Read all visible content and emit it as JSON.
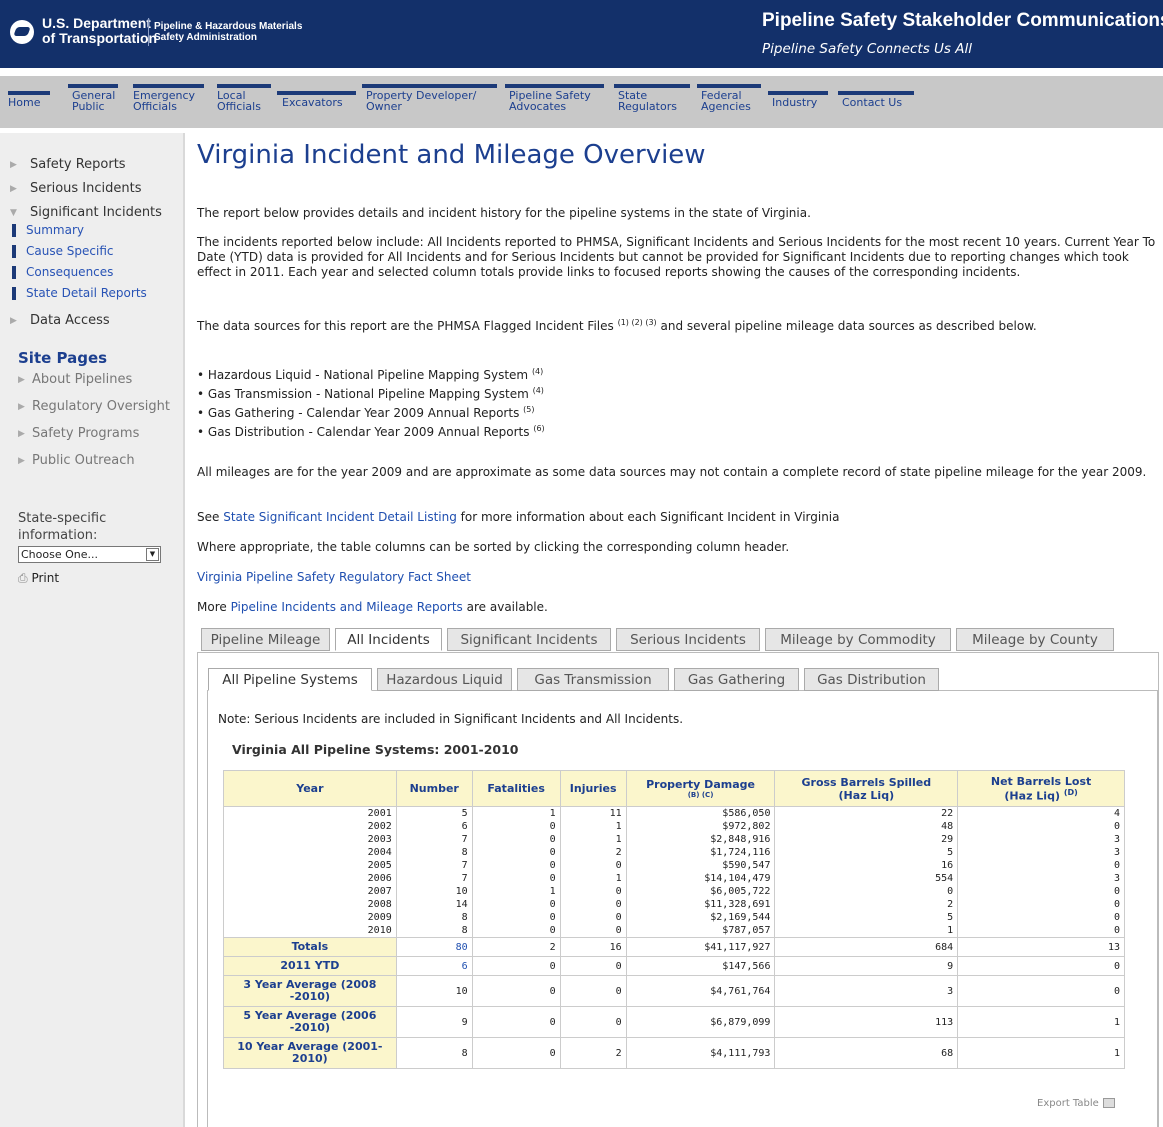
{
  "header": {
    "dept_line1": "U.S. Department",
    "dept_line2": "of Transportation",
    "phmsa_line1": "Pipeline & Hazardous Materials",
    "phmsa_line2": "Safety Administration",
    "title": "Pipeline Safety Stakeholder Communications",
    "subtitle": "Pipeline Safety Connects Us All"
  },
  "nav": {
    "home": "Home",
    "general_public_1": "General",
    "general_public_2": "Public",
    "emergency_1": "Emergency",
    "emergency_2": "Officials",
    "local_1": "Local",
    "local_2": "Officials",
    "excavators": "Excavators",
    "property_1": "Property Developer/",
    "property_2": "Owner",
    "advocates_1": "Pipeline Safety",
    "advocates_2": "Advocates",
    "state_1": "State",
    "state_2": "Regulators",
    "federal_1": "Federal",
    "federal_2": "Agencies",
    "industry": "Industry",
    "contact": "Contact Us"
  },
  "sidebar": {
    "safety_reports": "Safety Reports",
    "serious_incidents": "Serious Incidents",
    "significant_incidents": "Significant Incidents",
    "summary": "Summary",
    "cause_specific": "Cause Specific",
    "consequences": "Consequences",
    "state_detail": "State Detail Reports",
    "data_access": "Data Access",
    "site_pages": "Site Pages",
    "about": "About Pipelines",
    "regulatory": "Regulatory Oversight",
    "safety_programs": "Safety Programs",
    "public_outreach": "Public Outreach",
    "state_label_1": "State-specific",
    "state_label_2": "information:",
    "select_value": "Choose One...",
    "print": "Print"
  },
  "main": {
    "title": "Virginia Incident and Mileage Overview",
    "p1": "The report below provides details and incident history for the pipeline systems in the state of Virginia.",
    "p2": "The incidents reported below include: All Incidents reported to PHMSA, Significant Incidents and Serious Incidents for the most recent 10 years. Current Year To Date (YTD) data is provided for All Incidents and for Serious Incidents but cannot be provided for Significant Incidents due to reporting changes which took effect in 2011. Each year and selected column totals provide links to focused reports showing the causes of the corresponding incidents.",
    "p3": "The data sources for this report are the PHMSA Flagged Incident Files",
    "p3_refs": "(1) (2) (3)",
    "p3_tail": "and several pipeline mileage data sources as described below.",
    "bullets": [
      {
        "text": "Hazardous Liquid - National Pipeline Mapping System",
        "ref": "(4)"
      },
      {
        "text": "Gas Transmission - National Pipeline Mapping System",
        "ref": "(4)"
      },
      {
        "text": "Gas Gathering - Calendar Year 2009 Annual Reports",
        "ref": "(5)"
      },
      {
        "text": "Gas Distribution - Calendar Year 2009 Annual Reports",
        "ref": "(6)"
      }
    ],
    "p4": "All mileages are for the year 2009 and are approximate as some data sources may not contain a complete record of state pipeline mileage for the year 2009.",
    "p5_pre": "See",
    "p5_link": "State Significant Incident Detail Listing",
    "p5_post": "for more information about each Significant Incident in Virginia",
    "p6": "Where appropriate, the table columns can be sorted by clicking the corresponding column header.",
    "fact_sheet": "Virginia Pipeline Safety Regulatory Fact Sheet",
    "p7_pre": "More",
    "p7_link": "Pipeline Incidents and Mileage Reports",
    "p7_post": "are available."
  },
  "tabs1": [
    "Pipeline Mileage",
    "All Incidents",
    "Significant Incidents",
    "Serious Incidents",
    "Mileage by Commodity",
    "Mileage by County"
  ],
  "tabs2": [
    "All Pipeline Systems",
    "Hazardous Liquid",
    "Gas Transmission",
    "Gas Gathering",
    "Gas Distribution"
  ],
  "note": "Note: Serious Incidents are included in Significant Incidents and All Incidents.",
  "table_title": "Virginia All Pipeline Systems: 2001-2010",
  "table": {
    "headers": {
      "year": "Year",
      "number": "Number",
      "fatalities": "Fatalities",
      "injuries": "Injuries",
      "property": "Property Damage",
      "property_refs": "(B) (C)",
      "gross_1": "Gross Barrels Spilled",
      "gross_2": "(Haz Liq)",
      "net_1": "Net Barrels Lost",
      "net_2": "(Haz Liq)",
      "net_ref": "(D)"
    },
    "rows": [
      [
        "2001",
        "5",
        "1",
        "11",
        "$586,050",
        "22",
        "4"
      ],
      [
        "2002",
        "6",
        "0",
        "1",
        "$972,802",
        "48",
        "0"
      ],
      [
        "2003",
        "7",
        "0",
        "1",
        "$2,848,916",
        "29",
        "3"
      ],
      [
        "2004",
        "8",
        "0",
        "2",
        "$1,724,116",
        "5",
        "3"
      ],
      [
        "2005",
        "7",
        "0",
        "0",
        "$590,547",
        "16",
        "0"
      ],
      [
        "2006",
        "7",
        "0",
        "1",
        "$14,104,479",
        "554",
        "3"
      ],
      [
        "2007",
        "10",
        "1",
        "0",
        "$6,005,722",
        "0",
        "0"
      ],
      [
        "2008",
        "14",
        "0",
        "0",
        "$11,328,691",
        "2",
        "0"
      ],
      [
        "2009",
        "8",
        "0",
        "0",
        "$2,169,544",
        "5",
        "0"
      ],
      [
        "2010",
        "8",
        "0",
        "0",
        "$787,057",
        "1",
        "0"
      ]
    ],
    "summary": [
      [
        "Totals",
        "80",
        "2",
        "16",
        "$41,117,927",
        "684",
        "13"
      ],
      [
        "2011 YTD",
        "6",
        "0",
        "0",
        "$147,566",
        "9",
        "0"
      ],
      [
        "3 Year Average (2008 -2010)",
        "10",
        "0",
        "0",
        "$4,761,764",
        "3",
        "0"
      ],
      [
        "5 Year Average (2006 -2010)",
        "9",
        "0",
        "0",
        "$6,879,099",
        "113",
        "1"
      ],
      [
        "10 Year Average (2001-2010)",
        "8",
        "0",
        "2",
        "$4,111,793",
        "68",
        "1"
      ]
    ]
  },
  "export": "Export Table"
}
